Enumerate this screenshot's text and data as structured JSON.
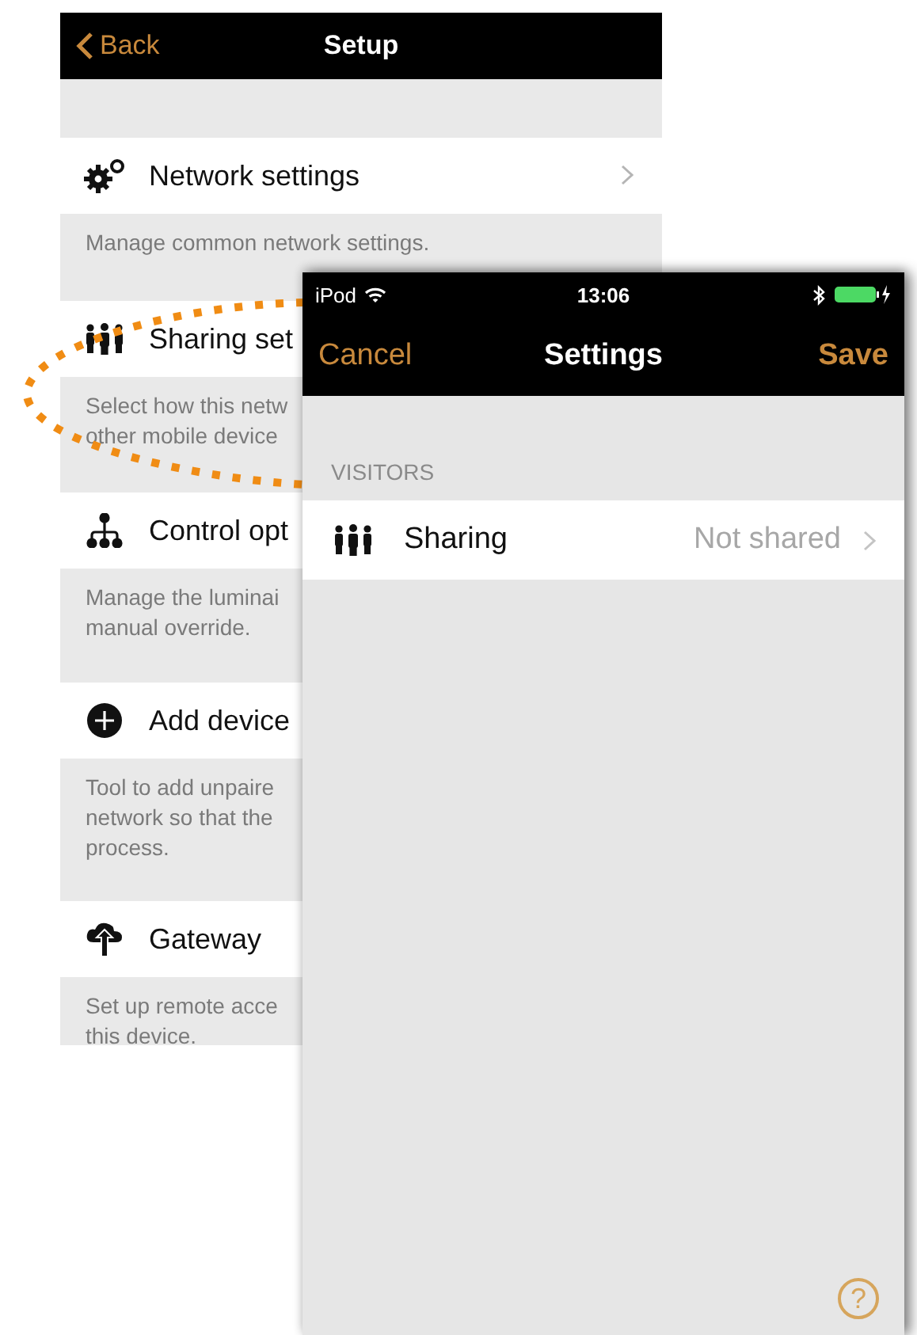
{
  "setup_screen": {
    "back_button": "Back",
    "title": "Setup",
    "items": [
      {
        "kind": "gears",
        "label": "Network settings",
        "chevron": true,
        "description": [
          "Manage common network settings."
        ]
      },
      {
        "kind": "people",
        "label": "Sharing set",
        "chevron": false,
        "description": [
          "Select how this netw",
          "other mobile device"
        ]
      },
      {
        "kind": "hierarchy",
        "label": "Control opt",
        "chevron": false,
        "description": [
          "Manage the luminai",
          "manual override."
        ]
      },
      {
        "kind": "plus",
        "label": "Add device",
        "chevron": false,
        "description": [
          "Tool to add unpaire",
          "network so that the",
          "process."
        ]
      },
      {
        "kind": "cloud",
        "label": "Gateway",
        "chevron": false,
        "description": [
          "Set up remote acce",
          "this device."
        ]
      }
    ]
  },
  "settings_screen": {
    "status_bar": {
      "carrier": "iPod",
      "time": "13:06"
    },
    "nav": {
      "cancel": "Cancel",
      "title": "Settings",
      "save": "Save"
    },
    "section_header": "VISITORS",
    "rows": [
      {
        "kind": "people",
        "label": "Sharing",
        "value": "Not shared"
      }
    ],
    "help_button": "?"
  }
}
